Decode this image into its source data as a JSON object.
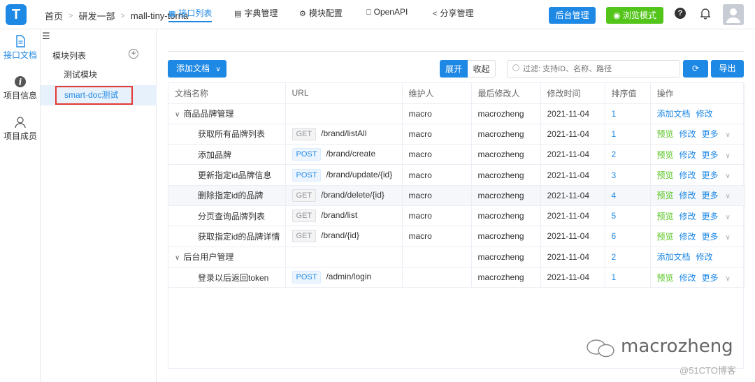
{
  "app": {
    "logo_letter": "T"
  },
  "breadcrumb": [
    "首页",
    "研发一部",
    "mall-tiny-torna"
  ],
  "header": {
    "admin_button": "后台管理",
    "browse_button": "浏览模式",
    "help_icon": "question-circle-icon",
    "bell_icon": "bell-icon",
    "avatar_icon": "user-avatar-icon"
  },
  "rail": [
    {
      "label": "接口文档",
      "icon": "document-icon",
      "active": true
    },
    {
      "label": "项目信息",
      "icon": "info-icon",
      "active": false
    },
    {
      "label": "项目成员",
      "icon": "user-icon",
      "active": false
    }
  ],
  "modules": {
    "title": "模块列表",
    "add_icon": "plus-circle-icon",
    "items": [
      {
        "label": "测试模块"
      },
      {
        "label": "smart-doc测试",
        "selected": true
      }
    ]
  },
  "tabs": [
    {
      "label": "接口列表",
      "icon": "grid-icon",
      "active": true
    },
    {
      "label": "字典管理",
      "icon": "book-icon"
    },
    {
      "label": "模块配置",
      "icon": "gear-icon"
    },
    {
      "label": "OpenAPI",
      "icon": "bookmark-icon"
    },
    {
      "label": "分享管理",
      "icon": "share-icon"
    }
  ],
  "toolbar": {
    "add_doc": "添加文档",
    "expand": "展开",
    "collapse": "收起",
    "filter_placeholder": "过滤: 支持ID、名称、路径",
    "export": "导出",
    "refresh_icon": "refresh-icon"
  },
  "table": {
    "headers": [
      "文档名称",
      "URL",
      "维护人",
      "最后修改人",
      "修改时间",
      "排序值",
      "操作"
    ],
    "rows": [
      {
        "type": "group",
        "name": "商品品牌管理",
        "url": "",
        "maintainer": "macro",
        "modifier": "macrozheng",
        "time": "2021-11-04",
        "order": "1",
        "actions": [
          "添加文档",
          "修改"
        ]
      },
      {
        "type": "leaf",
        "name": "获取所有品牌列表",
        "method": "GET",
        "path": "/brand/listAll",
        "maintainer": "macro",
        "modifier": "macrozheng",
        "time": "2021-11-04",
        "order": "1",
        "actions": [
          "预览",
          "修改",
          "更多"
        ]
      },
      {
        "type": "leaf",
        "name": "添加品牌",
        "method": "POST",
        "path": "/brand/create",
        "maintainer": "macro",
        "modifier": "macrozheng",
        "time": "2021-11-04",
        "order": "2",
        "actions": [
          "预览",
          "修改",
          "更多"
        ]
      },
      {
        "type": "leaf",
        "name": "更新指定id品牌信息",
        "method": "POST",
        "path": "/brand/update/{id}",
        "maintainer": "macro",
        "modifier": "macrozheng",
        "time": "2021-11-04",
        "order": "3",
        "actions": [
          "预览",
          "修改",
          "更多"
        ]
      },
      {
        "type": "leaf",
        "name": "删除指定id的品牌",
        "method": "GET",
        "path": "/brand/delete/{id}",
        "maintainer": "macro",
        "modifier": "macrozheng",
        "time": "2021-11-04",
        "order": "4",
        "actions": [
          "预览",
          "修改",
          "更多"
        ],
        "highlight": true
      },
      {
        "type": "leaf",
        "name": "分页查询品牌列表",
        "method": "GET",
        "path": "/brand/list",
        "maintainer": "macro",
        "modifier": "macrozheng",
        "time": "2021-11-04",
        "order": "5",
        "actions": [
          "预览",
          "修改",
          "更多"
        ]
      },
      {
        "type": "leaf",
        "name": "获取指定id的品牌详情",
        "method": "GET",
        "path": "/brand/{id}",
        "maintainer": "macro",
        "modifier": "macrozheng",
        "time": "2021-11-04",
        "order": "6",
        "actions": [
          "预览",
          "修改",
          "更多"
        ]
      },
      {
        "type": "group",
        "name": "后台用户管理",
        "url": "",
        "maintainer": "",
        "modifier": "macrozheng",
        "time": "2021-11-04",
        "order": "2",
        "actions": [
          "添加文档",
          "修改"
        ]
      },
      {
        "type": "leaf",
        "name": "登录以后返回token",
        "method": "POST",
        "path": "/admin/login",
        "maintainer": "",
        "modifier": "macrozheng",
        "time": "2021-11-04",
        "order": "1",
        "actions": [
          "预览",
          "修改",
          "更多"
        ]
      }
    ]
  },
  "watermark": {
    "brand": "macrozheng",
    "site": "@51CTO博客"
  },
  "colors": {
    "primary": "#1e88e5",
    "success": "#52c41a",
    "danger": "#e53935"
  }
}
